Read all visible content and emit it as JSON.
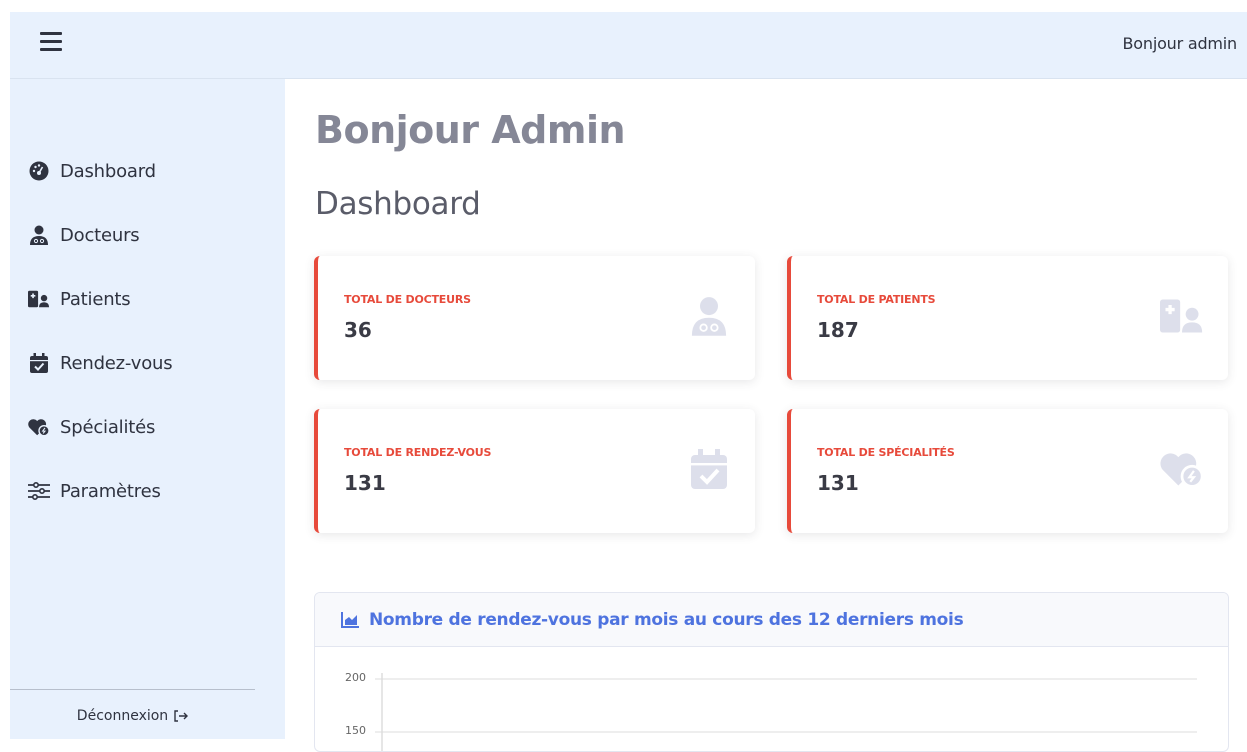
{
  "topbar": {
    "greeting": "Bonjour admin"
  },
  "sidebar": {
    "items": [
      {
        "label": "Dashboard",
        "icon": "tachometer-icon"
      },
      {
        "label": "Docteurs",
        "icon": "doctor-icon"
      },
      {
        "label": "Patients",
        "icon": "hospital-user-icon"
      },
      {
        "label": "Rendez-vous",
        "icon": "calendar-check-icon"
      },
      {
        "label": "Spécialités",
        "icon": "heart-icon"
      },
      {
        "label": "Paramètres",
        "icon": "sliders-icon"
      }
    ],
    "logout": "Déconnexion"
  },
  "main": {
    "page_title": "Bonjour Admin",
    "section_title": "Dashboard",
    "cards": [
      {
        "label": "TOTAL DE DOCTEURS",
        "value": "36",
        "icon": "doctor-icon"
      },
      {
        "label": "TOTAL DE PATIENTS",
        "value": "187",
        "icon": "hospital-user-icon"
      },
      {
        "label": "TOTAL DE RENDEZ-VOUS",
        "value": "131",
        "icon": "calendar-check-icon"
      },
      {
        "label": "TOTAL DE SPÉCIALITÉS",
        "value": "131",
        "icon": "heart-icon"
      }
    ]
  },
  "colors": {
    "accent": "#e74a3b",
    "primary": "#4e73df",
    "sidebar_bg": "#e8f1fd",
    "icon_muted": "#dddfeb"
  },
  "chart_data": {
    "type": "line",
    "title": "Nombre de rendez-vous par mois au cours des 12 derniers mois",
    "y_ticks": [
      "200",
      "150"
    ],
    "grid": true
  }
}
